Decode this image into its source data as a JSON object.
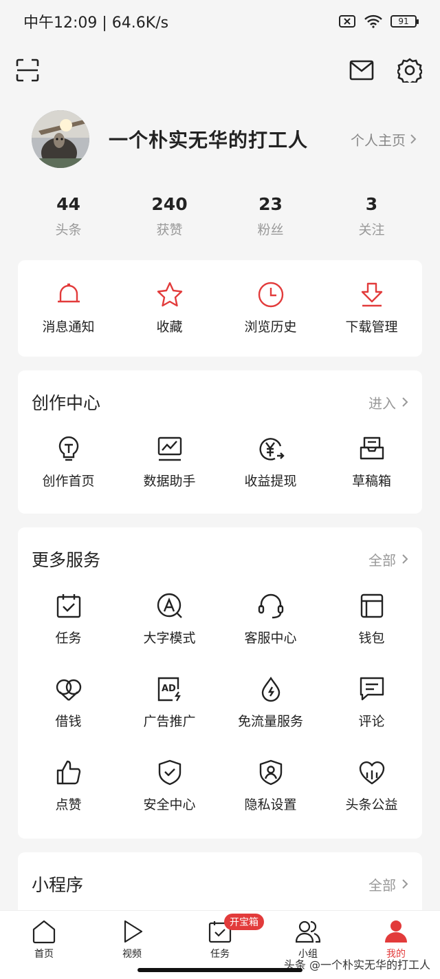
{
  "status_bar": {
    "time_speed": "中午12:09 | 64.6K/s",
    "battery": "91"
  },
  "user": {
    "name": "一个朴实无华的打工人",
    "home_link": "个人主页"
  },
  "stats": [
    {
      "value": "44",
      "label": "头条"
    },
    {
      "value": "240",
      "label": "获赞"
    },
    {
      "value": "23",
      "label": "粉丝"
    },
    {
      "value": "3",
      "label": "关注"
    }
  ],
  "quick_actions": [
    {
      "label": "消息通知",
      "icon": "bell-icon"
    },
    {
      "label": "收藏",
      "icon": "star-icon"
    },
    {
      "label": "浏览历史",
      "icon": "clock-icon"
    },
    {
      "label": "下载管理",
      "icon": "download-icon"
    }
  ],
  "creator": {
    "title": "创作中心",
    "more": "进入",
    "items": [
      {
        "label": "创作首页",
        "icon": "lightbulb-icon"
      },
      {
        "label": "数据助手",
        "icon": "chart-icon"
      },
      {
        "label": "收益提现",
        "icon": "yuan-icon"
      },
      {
        "label": "草稿箱",
        "icon": "draft-box-icon"
      }
    ]
  },
  "services": {
    "title": "更多服务",
    "more": "全部",
    "items": [
      {
        "label": "任务",
        "icon": "calendar-check-icon"
      },
      {
        "label": "大字模式",
        "icon": "font-a-icon"
      },
      {
        "label": "客服中心",
        "icon": "headset-icon"
      },
      {
        "label": "钱包",
        "icon": "wallet-icon"
      },
      {
        "label": "借钱",
        "icon": "loan-icon"
      },
      {
        "label": "广告推广",
        "icon": "ad-icon"
      },
      {
        "label": "免流量服务",
        "icon": "data-drop-icon"
      },
      {
        "label": "评论",
        "icon": "comment-icon"
      },
      {
        "label": "点赞",
        "icon": "thumbs-up-icon"
      },
      {
        "label": "安全中心",
        "icon": "shield-check-icon"
      },
      {
        "label": "隐私设置",
        "icon": "privacy-shield-icon"
      },
      {
        "label": "头条公益",
        "icon": "charity-heart-icon"
      }
    ]
  },
  "mini_programs": {
    "title": "小程序",
    "more": "全部"
  },
  "tabs": [
    {
      "label": "首页",
      "icon": "home-icon"
    },
    {
      "label": "视频",
      "icon": "play-icon"
    },
    {
      "label": "任务",
      "icon": "task-icon",
      "badge": "开宝箱"
    },
    {
      "label": "小组",
      "icon": "group-icon"
    },
    {
      "label": "我的",
      "icon": "person-icon",
      "active": true
    }
  ],
  "watermark": "头条 @一个朴实无华的打工人",
  "colors": {
    "accent": "#e23b3b",
    "background": "#f5f5f5",
    "card": "#ffffff"
  }
}
